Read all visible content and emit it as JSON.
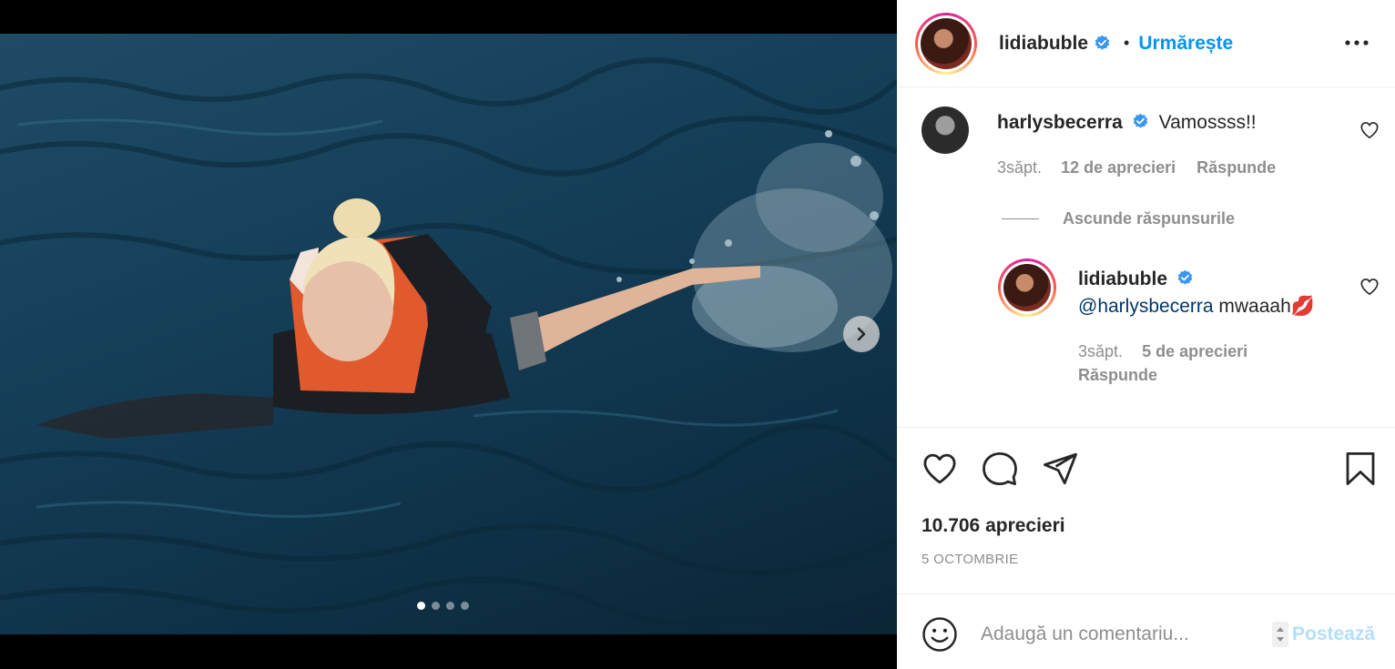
{
  "post": {
    "author": "lidiabuble",
    "follow_label": "Urmărește",
    "separator": "•",
    "likes_text": "10.706 aprecieri",
    "date_text": "5 OCTOMBRIE",
    "carousel_total": 4,
    "carousel_current": 1
  },
  "comments": [
    {
      "username": "harlysbecerra",
      "verified": true,
      "text": "Vamossss!!",
      "time": "3săpt.",
      "likes": "12 de aprecieri",
      "reply_label": "Răspunde"
    }
  ],
  "hide_replies_label": "Ascunde răspunsurile",
  "replies": [
    {
      "username": "lidiabuble",
      "verified": true,
      "mention": "@harlysbecerra",
      "text": " mwaaah💋",
      "time": "3săpt.",
      "likes": "5 de aprecieri",
      "reply_label": "Răspunde"
    }
  ],
  "add_comment": {
    "placeholder": "Adaugă un comentariu...",
    "post_label": "Postează"
  },
  "icons": {
    "more": "more-options-icon",
    "next": "chevron-right-icon",
    "like": "heart-icon",
    "comment": "comment-icon",
    "share": "paper-plane-icon",
    "save": "bookmark-icon",
    "emoji": "emoji-icon"
  },
  "colors": {
    "accent": "#0095f6",
    "verified": "#3897f0",
    "muted": "#8e8e8e",
    "post_disabled": "#b2dffc"
  }
}
